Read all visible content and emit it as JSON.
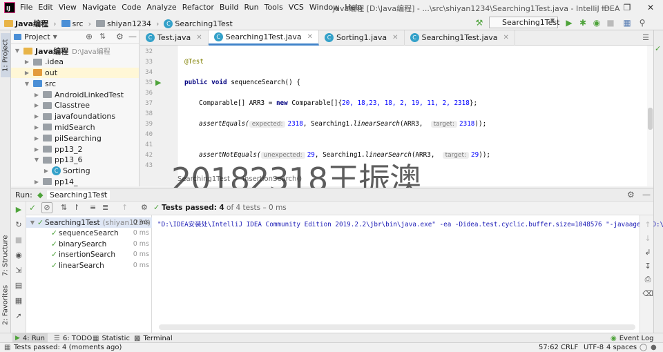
{
  "menu": [
    "File",
    "Edit",
    "View",
    "Navigate",
    "Code",
    "Analyze",
    "Refactor",
    "Build",
    "Run",
    "Tools",
    "VCS",
    "Window",
    "Help"
  ],
  "window_title": "Java编程 [D:\\Java编程] - ...\\src\\shiyan1234\\Searching1Test.java - IntelliJ IDEA",
  "breadcrumb": {
    "project": "Java编程",
    "src": "src",
    "package": "shiyan1234",
    "file": "Searching1Test"
  },
  "run_config": "Searching1Test",
  "project_panel": {
    "title": "Project",
    "items": [
      {
        "label": "Java编程",
        "path": "D:\\Java编程",
        "indent": 0,
        "type": "root"
      },
      {
        "label": ".idea",
        "indent": 1,
        "type": "grey"
      },
      {
        "label": "out",
        "indent": 1,
        "type": "orange"
      },
      {
        "label": "src",
        "indent": 1,
        "type": "blue"
      },
      {
        "label": "AndroidLinkedTest",
        "indent": 2,
        "type": "grey"
      },
      {
        "label": "Classtree",
        "indent": 2,
        "type": "grey"
      },
      {
        "label": "javafoundations",
        "indent": 2,
        "type": "grey"
      },
      {
        "label": "midSearch",
        "indent": 2,
        "type": "grey"
      },
      {
        "label": "pilSearching",
        "indent": 2,
        "type": "grey"
      },
      {
        "label": "pp13_2",
        "indent": 2,
        "type": "grey"
      },
      {
        "label": "pp13_6",
        "indent": 2,
        "type": "grey"
      },
      {
        "label": "Sorting",
        "indent": 3,
        "type": "java"
      },
      {
        "label": "pp14_",
        "indent": 2,
        "type": "grey"
      }
    ]
  },
  "tabs": [
    {
      "label": "Test.java",
      "active": false
    },
    {
      "label": "Searching1Test.java",
      "active": true
    },
    {
      "label": "Sorting1.java",
      "active": false
    },
    {
      "label": "Searching1Test.java",
      "active": false
    }
  ],
  "code_lines": [
    {
      "n": "32",
      "text": ""
    },
    {
      "n": "33",
      "text": "@Test"
    },
    {
      "n": "34",
      "text": ""
    },
    {
      "n": "35",
      "text": "public void sequenceSearch() {"
    },
    {
      "n": "36",
      "text": ""
    },
    {
      "n": "37",
      "text": "Comparable[] ARR3 = new Comparable[]{20, 18,23, 18, 2, 19, 11, 2, 2318};"
    },
    {
      "n": "38",
      "text": ""
    },
    {
      "n": "39",
      "text": "assertEquals( expected: 2318, Searching1.linearSearch(ARR3,  target: 2318));"
    },
    {
      "n": "40",
      "text": ""
    },
    {
      "n": "41",
      "text": ""
    },
    {
      "n": "42",
      "text": "assertNotEquals( unexpected: 29, Searching1.linearSearch(ARR3,  target: 29));"
    },
    {
      "n": "43",
      "text": ""
    }
  ],
  "code": {
    "ann": "@Test",
    "sig_kw": "public void",
    "sig": "sequenceSearch() {",
    "l37a": "Comparable[] ARR3 = ",
    "l37kw": "new",
    "l37b": " Comparable[]{",
    "l37nums": "20, 18,23, 18, 2, 19, 11, 2, 2318",
    "l37c": "};",
    "assert1": "assertEquals(",
    "hint_expected": "expected:",
    "v2318": "2318",
    "call1": ", Searching1.",
    "linear": "linearSearch",
    "arr": "(ARR3,",
    "hint_target": "target:",
    "end": "));",
    "assert2": "assertNotEquals(",
    "hint_unexpected": "unexpected:",
    "v29": "29"
  },
  "editor_breadcrumb": {
    "a": "Searching1Test",
    "b": "insertionSearch()"
  },
  "watermark": "20182318王振澳",
  "run_panel": {
    "label": "Run:",
    "config": "Searching1Test",
    "status_prefix": "Tests passed:",
    "status_count": "4",
    "status_suffix": "of 4 tests – 0 ms",
    "tree": [
      {
        "label": "Searching1Test",
        "extra": "(shiyan1234)",
        "time": "0 ms",
        "level": 0
      },
      {
        "label": "sequenceSearch",
        "time": "0 ms",
        "level": 1
      },
      {
        "label": "binarySearch",
        "time": "0 ms",
        "level": 1
      },
      {
        "label": "insertionSearch",
        "time": "0 ms",
        "level": 1
      },
      {
        "label": "linearSearch",
        "time": "0 ms",
        "level": 1
      }
    ],
    "console": "\"D:\\IDEA安装处\\IntelliJ IDEA Community Edition 2019.2.2\\jbr\\bin\\java.exe\" -ea -Didea.test.cyclic.buffer.size=1048576 \"-javaagent:D:\\IDEA安装"
  },
  "left_strip": {
    "project": "1: Project",
    "structure": "7: Structure",
    "favorites": "2: Favorites"
  },
  "toolwindows": [
    {
      "label": "4: Run"
    },
    {
      "label": "6: TODO"
    },
    {
      "label": "Statistic"
    },
    {
      "label": "Terminal"
    }
  ],
  "event_log": "Event Log",
  "status": {
    "message": "Tests passed: 4 (moments ago)",
    "position": "57:62",
    "line_sep": "CRLF",
    "encoding": "UTF-8",
    "indent": "4 spaces"
  },
  "colors": {
    "accent": "#4083c9",
    "pass": "#4ea33a",
    "keyword": "#000080",
    "number": "#0000ff"
  }
}
